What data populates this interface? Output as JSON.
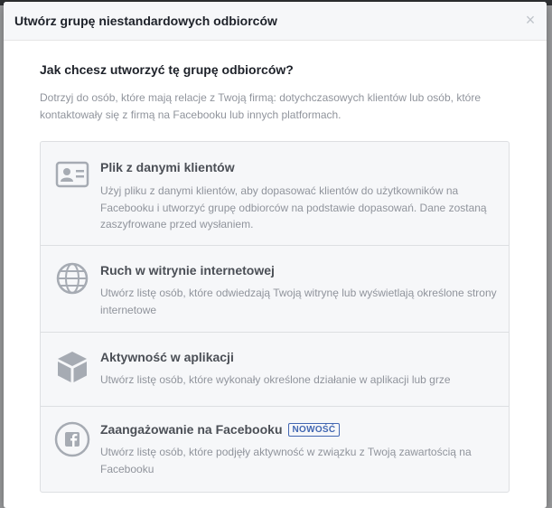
{
  "dialog": {
    "title": "Utwórz grupę niestandardowych odbiorców",
    "close_glyph": "×",
    "question": "Jak chcesz utworzyć tę grupę odbiorców?",
    "intro": "Dotrzyj do osób, które mają relacje z Twoją firmą: dotychczasowych klientów lub osób, które kontaktowały się z firmą na Facebooku lub innych platformach."
  },
  "options": [
    {
      "title": "Plik z danymi klientów",
      "description": "Użyj pliku z danymi klientów, aby dopasować klientów do użytkowników na Facebooku i utworzyć grupę odbiorców na podstawie dopasowań. Dane zostaną zaszyfrowane przed wysłaniem.",
      "icon": "contact-card-icon"
    },
    {
      "title": "Ruch w witrynie internetowej",
      "description": "Utwórz listę osób, które odwiedzają Twoją witrynę lub wyświetlają określone strony internetowe",
      "icon": "globe-icon"
    },
    {
      "title": "Aktywność w aplikacji",
      "description": "Utwórz listę osób, które wykonały określone działanie w aplikacji lub grze",
      "icon": "app-box-icon"
    },
    {
      "title": "Zaangażowanie na Facebooku",
      "badge": "NOWOŚĆ",
      "description": "Utwórz listę osób, które podjęły aktywność w związku z Twoją zawartością na Facebooku",
      "icon": "facebook-icon"
    }
  ],
  "colors": {
    "accent": "#4267b2",
    "icon_gray": "#a6abb3",
    "title_text": "#4b4f56",
    "muted_text": "#90949c"
  }
}
